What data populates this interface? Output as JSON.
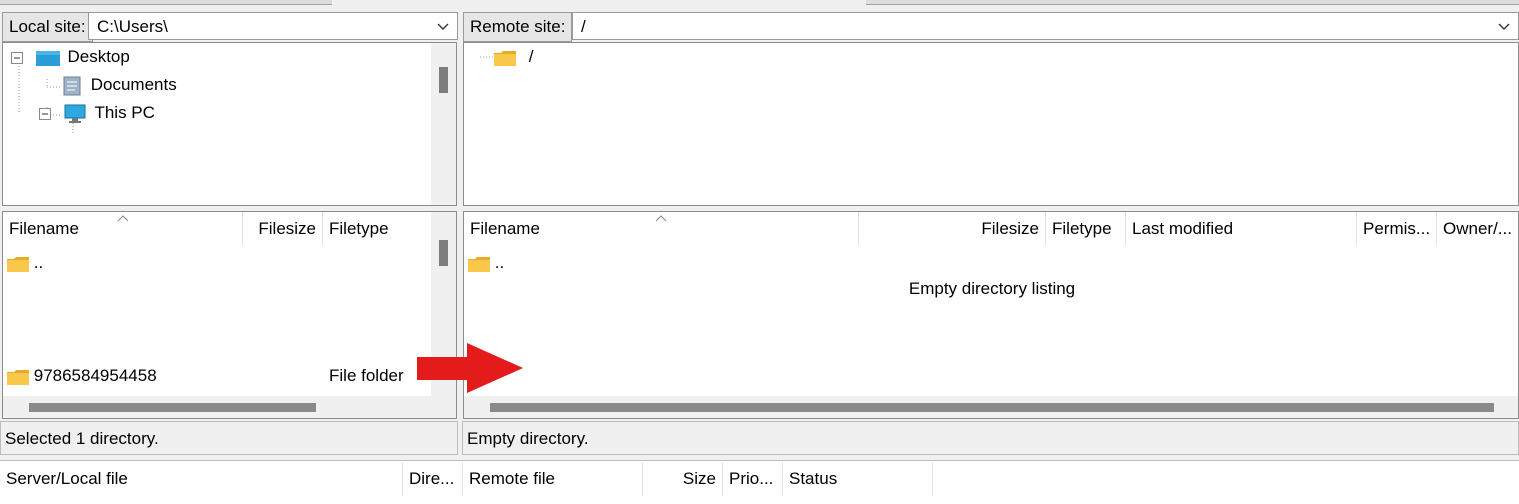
{
  "local_site": {
    "label": "Local site:",
    "path": "C:\\Users\\",
    "tree": [
      {
        "label": "Desktop",
        "icon": "desktop-icon"
      },
      {
        "label": "Documents",
        "icon": "documents-icon"
      },
      {
        "label": "This PC",
        "icon": "computer-icon"
      }
    ]
  },
  "remote_site": {
    "label": "Remote site:",
    "path": "/",
    "tree": [
      {
        "label": "/",
        "icon": "folder-icon"
      }
    ]
  },
  "local_list": {
    "columns": [
      "Filename",
      "Filesize",
      "Filetype"
    ],
    "rows": [
      {
        "name": "..",
        "size": "",
        "type": ""
      },
      {
        "name": "9786584954458",
        "size": "",
        "type": "File folder"
      }
    ],
    "status": "Selected 1 directory."
  },
  "remote_list": {
    "columns": [
      "Filename",
      "Filesize",
      "Filetype",
      "Last modified",
      "Permis...",
      "Owner/..."
    ],
    "rows": [
      {
        "name": ".."
      }
    ],
    "empty_message": "Empty directory listing",
    "status": "Empty directory."
  },
  "queue": {
    "columns": [
      "Server/Local file",
      "Dire...",
      "Remote file",
      "Size",
      "Prio...",
      "Status"
    ]
  },
  "colors": {
    "arrow": "#e31b1b",
    "folder": "#f7c84a",
    "folder_dark": "#e7ac27",
    "desktop": "#2b9ed8",
    "scroll": "#7d7d7d"
  }
}
